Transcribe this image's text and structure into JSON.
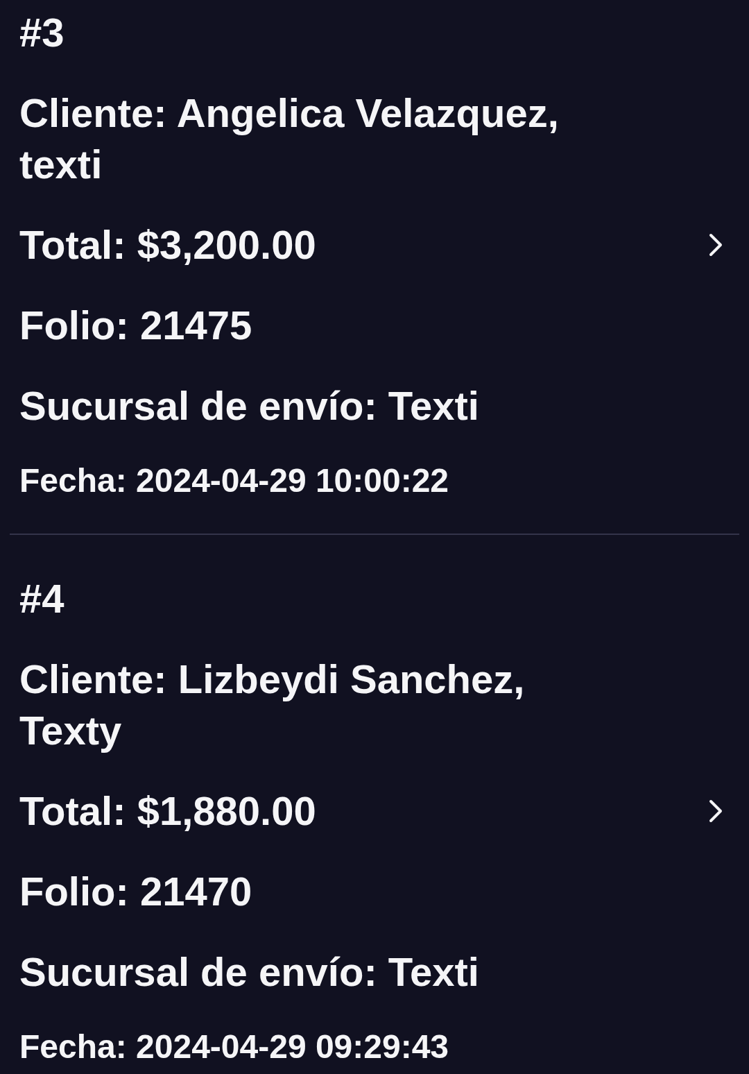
{
  "orders": [
    {
      "number": "#3",
      "client": "Cliente: Angelica Velazquez, texti",
      "total": "Total: $3,200.00",
      "folio": "Folio: 21475",
      "branch": "Sucursal de envío: Texti",
      "date": "Fecha: 2024-04-29 10:00:22"
    },
    {
      "number": "#4",
      "client": "Cliente: Lizbeydi Sanchez, Texty",
      "total": "Total: $1,880.00",
      "folio": "Folio: 21470",
      "branch": "Sucursal de envío: Texti",
      "date": "Fecha: 2024-04-29 09:29:43"
    }
  ]
}
